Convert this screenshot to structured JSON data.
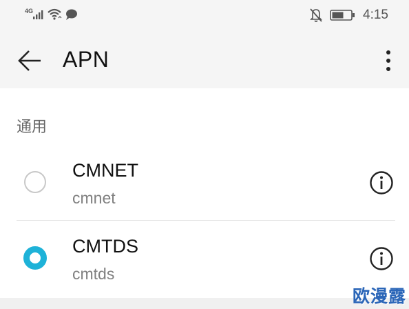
{
  "status_bar": {
    "network_type": "4G",
    "time": "4:15",
    "icons": [
      "signal-icon",
      "wifi-icon",
      "message-icon",
      "notifications-off-icon",
      "battery-icon"
    ]
  },
  "app_bar": {
    "title": "APN",
    "back_icon": "arrow-back-icon",
    "more_icon": "more-vertical-icon"
  },
  "section": {
    "header": "通用"
  },
  "apns": [
    {
      "name": "CMNET",
      "value": "cmnet",
      "selected": false
    },
    {
      "name": "CMTDS",
      "value": "cmtds",
      "selected": true
    }
  ],
  "colors": {
    "accent": "#1eb2d8",
    "radio_unselected": "#c8c8c8",
    "background": "#f5f5f5",
    "surface": "#ffffff"
  },
  "watermark": {
    "text": "欧漫露"
  }
}
